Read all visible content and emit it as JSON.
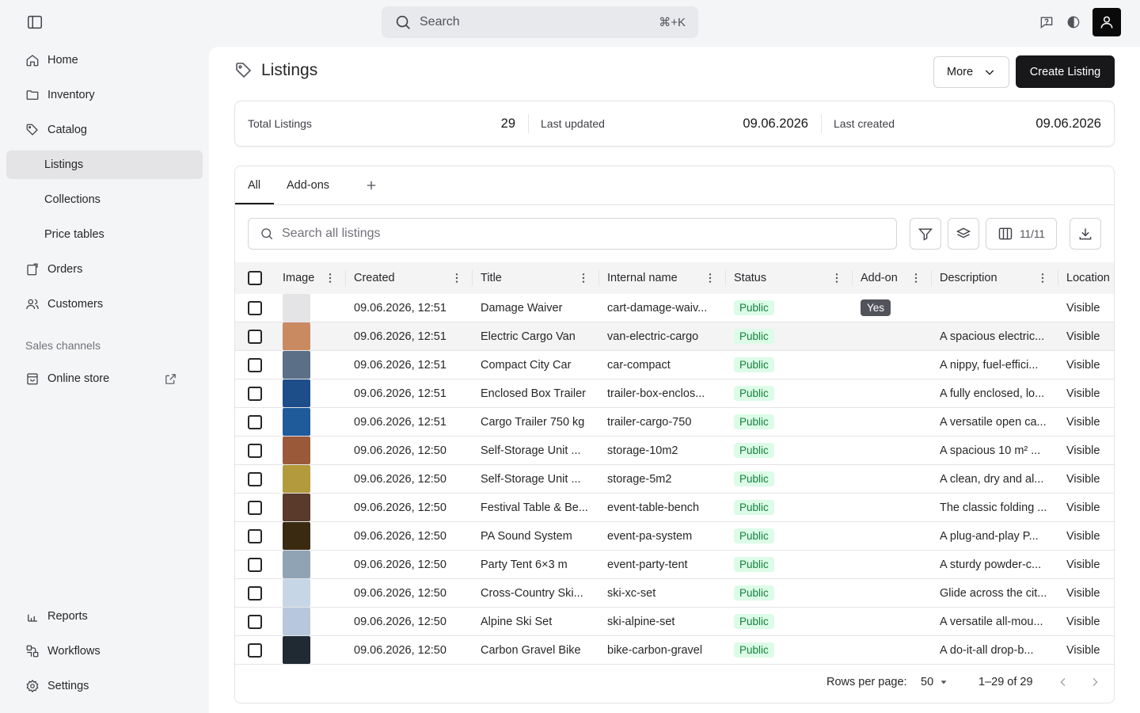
{
  "topbar": {
    "search_placeholder": "Search",
    "search_shortcut": "⌘+K",
    "icons": [
      "sidebar-toggle-icon",
      "help-icon",
      "theme-icon",
      "user-icon"
    ]
  },
  "sidebar": {
    "home": "Home",
    "inventory": "Inventory",
    "catalog": "Catalog",
    "listings": "Listings",
    "collections": "Collections",
    "price_tables": "Price tables",
    "orders": "Orders",
    "customers": "Customers",
    "sales_channels": "Sales channels",
    "online_store": "Online store",
    "reports": "Reports",
    "workflows": "Workflows",
    "settings": "Settings"
  },
  "page": {
    "title": "Listings",
    "more_label": "More",
    "create_label": "Create Listing"
  },
  "stats": {
    "total_label": "Total Listings",
    "total_value": "29",
    "updated_label": "Last updated",
    "updated_value": "09.06.2026",
    "created_label": "Last created",
    "created_value": "09.06.2026"
  },
  "tabs": {
    "all": "All",
    "addons": "Add-ons"
  },
  "toolbar": {
    "search_placeholder": "Search all listings",
    "columns_count": "11/11"
  },
  "table": {
    "headers": {
      "image": "Image",
      "created": "Created",
      "title": "Title",
      "internal": "Internal name",
      "status": "Status",
      "addon": "Add-on",
      "description": "Description",
      "location": "Location"
    },
    "rows": [
      {
        "created": "09.06.2026, 12:51",
        "title": "Damage Waiver",
        "internal": "cart-damage-waiv...",
        "status": "Public",
        "addon": "Yes",
        "description": "",
        "location": "Visible",
        "thumb": "#e4e4e7"
      },
      {
        "created": "09.06.2026, 12:51",
        "title": "Electric Cargo Van",
        "internal": "van-electric-cargo",
        "status": "Public",
        "addon": "",
        "description": "A spacious electric...",
        "location": "Visible",
        "thumb": "#c98a62"
      },
      {
        "created": "09.06.2026, 12:51",
        "title": "Compact City Car",
        "internal": "car-compact",
        "status": "Public",
        "addon": "",
        "description": "A nippy, fuel-effici...",
        "location": "Visible",
        "thumb": "#5b6f86"
      },
      {
        "created": "09.06.2026, 12:51",
        "title": "Enclosed Box Trailer",
        "internal": "trailer-box-enclos...",
        "status": "Public",
        "addon": "",
        "description": "A fully enclosed, lo...",
        "location": "Visible",
        "thumb": "#1d4e89"
      },
      {
        "created": "09.06.2026, 12:51",
        "title": "Cargo Trailer 750 kg",
        "internal": "trailer-cargo-750",
        "status": "Public",
        "addon": "",
        "description": "A versatile open ca...",
        "location": "Visible",
        "thumb": "#1f5a9a"
      },
      {
        "created": "09.06.2026, 12:50",
        "title": "Self-Storage Unit ...",
        "internal": "storage-10m2",
        "status": "Public",
        "addon": "",
        "description": "A spacious 10 m² ...",
        "location": "Visible",
        "thumb": "#9a5a3a"
      },
      {
        "created": "09.06.2026, 12:50",
        "title": "Self-Storage Unit ...",
        "internal": "storage-5m2",
        "status": "Public",
        "addon": "",
        "description": "A clean, dry and al...",
        "location": "Visible",
        "thumb": "#b39a3c"
      },
      {
        "created": "09.06.2026, 12:50",
        "title": "Festival Table & Be...",
        "internal": "event-table-bench",
        "status": "Public",
        "addon": "",
        "description": "The classic folding ...",
        "location": "Visible",
        "thumb": "#5a3a2a"
      },
      {
        "created": "09.06.2026, 12:50",
        "title": "PA Sound System",
        "internal": "event-pa-system",
        "status": "Public",
        "addon": "",
        "description": "A plug-and-play P...",
        "location": "Visible",
        "thumb": "#3a2a12"
      },
      {
        "created": "09.06.2026, 12:50",
        "title": "Party Tent 6×3 m",
        "internal": "event-party-tent",
        "status": "Public",
        "addon": "",
        "description": "A sturdy powder-c...",
        "location": "Visible",
        "thumb": "#8fa3b5"
      },
      {
        "created": "09.06.2026, 12:50",
        "title": "Cross-Country Ski...",
        "internal": "ski-xc-set",
        "status": "Public",
        "addon": "",
        "description": "Glide across the cit...",
        "location": "Visible",
        "thumb": "#c7d6e6"
      },
      {
        "created": "09.06.2026, 12:50",
        "title": "Alpine Ski Set",
        "internal": "ski-alpine-set",
        "status": "Public",
        "addon": "",
        "description": "A versatile all-mou...",
        "location": "Visible",
        "thumb": "#b8c8dc"
      },
      {
        "created": "09.06.2026, 12:50",
        "title": "Carbon Gravel Bike",
        "internal": "bike-carbon-gravel",
        "status": "Public",
        "addon": "",
        "description": "A do-it-all drop-b...",
        "location": "Visible",
        "thumb": "#1f2a33"
      }
    ]
  },
  "footer": {
    "rows_label": "Rows per page:",
    "rows_value": "50",
    "range": "1–29 of 29"
  }
}
